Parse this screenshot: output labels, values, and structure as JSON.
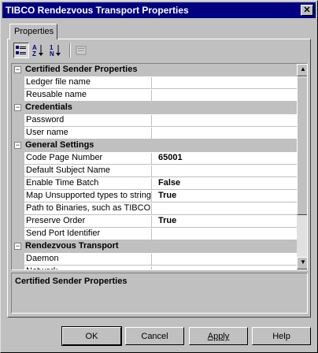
{
  "window": {
    "title": "TIBCO Rendezvous Transport Properties",
    "close_glyph": "✕"
  },
  "tabs": [
    {
      "label": "Properties"
    }
  ],
  "toolbar": [
    {
      "name": "categorized-view",
      "icon": "categorized-icon"
    },
    {
      "name": "sort-az",
      "icon": "sort-alpha-icon"
    },
    {
      "name": "sort-numeric",
      "icon": "sort-numeric-icon"
    },
    {
      "name": "property-pages",
      "icon": "property-pages-icon"
    }
  ],
  "grid": {
    "rows": [
      {
        "type": "category",
        "toggle": "−",
        "name": "Certified Sender Properties"
      },
      {
        "type": "property",
        "name": "Ledger file name",
        "value": ""
      },
      {
        "type": "property",
        "name": "Reusable name",
        "value": ""
      },
      {
        "type": "category",
        "toggle": "−",
        "name": "Credentials"
      },
      {
        "type": "property",
        "name": "Password",
        "value": ""
      },
      {
        "type": "property",
        "name": "User name",
        "value": ""
      },
      {
        "type": "category",
        "toggle": "−",
        "name": "General Settings"
      },
      {
        "type": "property",
        "name": "Code Page Number",
        "value": "65001"
      },
      {
        "type": "property",
        "name": "Default Subject Name",
        "value": ""
      },
      {
        "type": "property",
        "name": "Enable Time Batch",
        "value": "False"
      },
      {
        "type": "property",
        "name": "Map Unsupported types to string",
        "value": "True"
      },
      {
        "type": "property",
        "name": "Path to Binaries, such as TIBCO",
        "value": ""
      },
      {
        "type": "property",
        "name": "Preserve Order",
        "value": "True"
      },
      {
        "type": "property",
        "name": "Send Port Identifier",
        "value": ""
      },
      {
        "type": "category",
        "toggle": "−",
        "name": "Rendezvous Transport"
      },
      {
        "type": "property",
        "name": "Daemon",
        "value": ""
      },
      {
        "type": "property",
        "name": "Network",
        "value": ""
      }
    ],
    "scroll": {
      "up_glyph": "▲",
      "down_glyph": "▼"
    }
  },
  "description": {
    "title": "Certified Sender Properties"
  },
  "buttons": {
    "ok": "OK",
    "cancel": "Cancel",
    "apply": "Apply",
    "help": "Help"
  }
}
